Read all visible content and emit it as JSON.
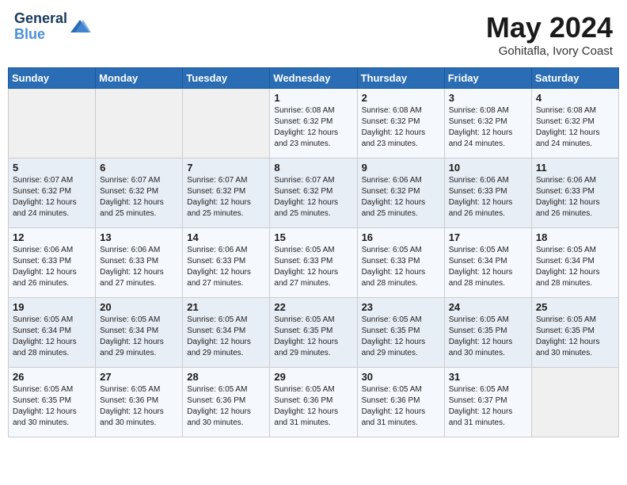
{
  "header": {
    "logo_line1": "General",
    "logo_line2": "Blue",
    "month": "May 2024",
    "location": "Gohitafla, Ivory Coast"
  },
  "weekdays": [
    "Sunday",
    "Monday",
    "Tuesday",
    "Wednesday",
    "Thursday",
    "Friday",
    "Saturday"
  ],
  "weeks": [
    [
      {
        "day": "",
        "info": ""
      },
      {
        "day": "",
        "info": ""
      },
      {
        "day": "",
        "info": ""
      },
      {
        "day": "1",
        "info": "Sunrise: 6:08 AM\nSunset: 6:32 PM\nDaylight: 12 hours\nand 23 minutes."
      },
      {
        "day": "2",
        "info": "Sunrise: 6:08 AM\nSunset: 6:32 PM\nDaylight: 12 hours\nand 23 minutes."
      },
      {
        "day": "3",
        "info": "Sunrise: 6:08 AM\nSunset: 6:32 PM\nDaylight: 12 hours\nand 24 minutes."
      },
      {
        "day": "4",
        "info": "Sunrise: 6:08 AM\nSunset: 6:32 PM\nDaylight: 12 hours\nand 24 minutes."
      }
    ],
    [
      {
        "day": "5",
        "info": "Sunrise: 6:07 AM\nSunset: 6:32 PM\nDaylight: 12 hours\nand 24 minutes."
      },
      {
        "day": "6",
        "info": "Sunrise: 6:07 AM\nSunset: 6:32 PM\nDaylight: 12 hours\nand 25 minutes."
      },
      {
        "day": "7",
        "info": "Sunrise: 6:07 AM\nSunset: 6:32 PM\nDaylight: 12 hours\nand 25 minutes."
      },
      {
        "day": "8",
        "info": "Sunrise: 6:07 AM\nSunset: 6:32 PM\nDaylight: 12 hours\nand 25 minutes."
      },
      {
        "day": "9",
        "info": "Sunrise: 6:06 AM\nSunset: 6:32 PM\nDaylight: 12 hours\nand 25 minutes."
      },
      {
        "day": "10",
        "info": "Sunrise: 6:06 AM\nSunset: 6:33 PM\nDaylight: 12 hours\nand 26 minutes."
      },
      {
        "day": "11",
        "info": "Sunrise: 6:06 AM\nSunset: 6:33 PM\nDaylight: 12 hours\nand 26 minutes."
      }
    ],
    [
      {
        "day": "12",
        "info": "Sunrise: 6:06 AM\nSunset: 6:33 PM\nDaylight: 12 hours\nand 26 minutes."
      },
      {
        "day": "13",
        "info": "Sunrise: 6:06 AM\nSunset: 6:33 PM\nDaylight: 12 hours\nand 27 minutes."
      },
      {
        "day": "14",
        "info": "Sunrise: 6:06 AM\nSunset: 6:33 PM\nDaylight: 12 hours\nand 27 minutes."
      },
      {
        "day": "15",
        "info": "Sunrise: 6:05 AM\nSunset: 6:33 PM\nDaylight: 12 hours\nand 27 minutes."
      },
      {
        "day": "16",
        "info": "Sunrise: 6:05 AM\nSunset: 6:33 PM\nDaylight: 12 hours\nand 28 minutes."
      },
      {
        "day": "17",
        "info": "Sunrise: 6:05 AM\nSunset: 6:34 PM\nDaylight: 12 hours\nand 28 minutes."
      },
      {
        "day": "18",
        "info": "Sunrise: 6:05 AM\nSunset: 6:34 PM\nDaylight: 12 hours\nand 28 minutes."
      }
    ],
    [
      {
        "day": "19",
        "info": "Sunrise: 6:05 AM\nSunset: 6:34 PM\nDaylight: 12 hours\nand 28 minutes."
      },
      {
        "day": "20",
        "info": "Sunrise: 6:05 AM\nSunset: 6:34 PM\nDaylight: 12 hours\nand 29 minutes."
      },
      {
        "day": "21",
        "info": "Sunrise: 6:05 AM\nSunset: 6:34 PM\nDaylight: 12 hours\nand 29 minutes."
      },
      {
        "day": "22",
        "info": "Sunrise: 6:05 AM\nSunset: 6:35 PM\nDaylight: 12 hours\nand 29 minutes."
      },
      {
        "day": "23",
        "info": "Sunrise: 6:05 AM\nSunset: 6:35 PM\nDaylight: 12 hours\nand 29 minutes."
      },
      {
        "day": "24",
        "info": "Sunrise: 6:05 AM\nSunset: 6:35 PM\nDaylight: 12 hours\nand 30 minutes."
      },
      {
        "day": "25",
        "info": "Sunrise: 6:05 AM\nSunset: 6:35 PM\nDaylight: 12 hours\nand 30 minutes."
      }
    ],
    [
      {
        "day": "26",
        "info": "Sunrise: 6:05 AM\nSunset: 6:35 PM\nDaylight: 12 hours\nand 30 minutes."
      },
      {
        "day": "27",
        "info": "Sunrise: 6:05 AM\nSunset: 6:36 PM\nDaylight: 12 hours\nand 30 minutes."
      },
      {
        "day": "28",
        "info": "Sunrise: 6:05 AM\nSunset: 6:36 PM\nDaylight: 12 hours\nand 30 minutes."
      },
      {
        "day": "29",
        "info": "Sunrise: 6:05 AM\nSunset: 6:36 PM\nDaylight: 12 hours\nand 31 minutes."
      },
      {
        "day": "30",
        "info": "Sunrise: 6:05 AM\nSunset: 6:36 PM\nDaylight: 12 hours\nand 31 minutes."
      },
      {
        "day": "31",
        "info": "Sunrise: 6:05 AM\nSunset: 6:37 PM\nDaylight: 12 hours\nand 31 minutes."
      },
      {
        "day": "",
        "info": ""
      }
    ]
  ]
}
